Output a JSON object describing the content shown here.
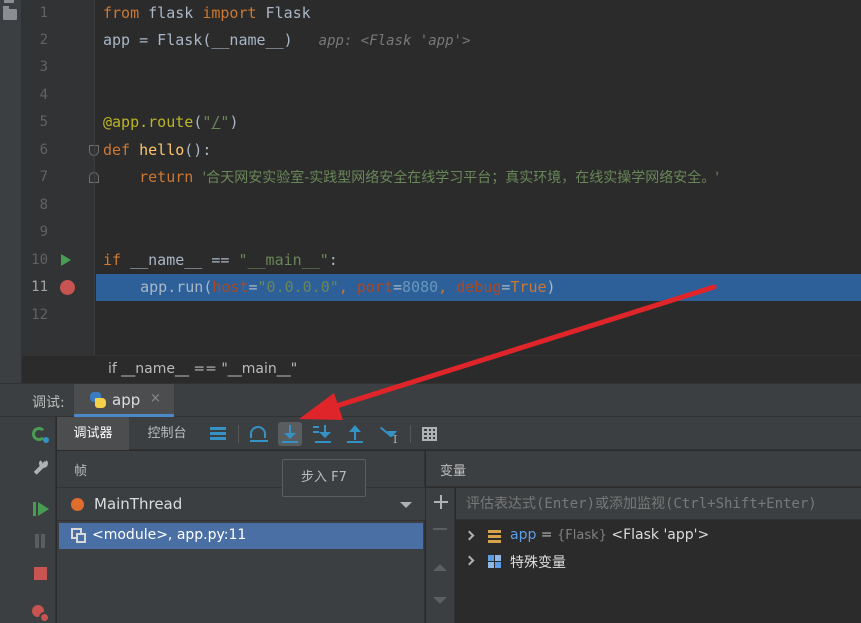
{
  "editor": {
    "line_numbers": [
      "1",
      "2",
      "3",
      "4",
      "5",
      "6",
      "7",
      "8",
      "9",
      "10",
      "11",
      "12"
    ],
    "lines": {
      "l1": {
        "kw1": "from",
        "mod": " flask ",
        "kw2": "import",
        "name": " Flask"
      },
      "l2": {
        "pre": "app = Flask(__name__)",
        "hint": "app: <Flask 'app'>"
      },
      "l5": {
        "dec": "@app.route",
        "p1": "(",
        "q1": "\"",
        "path": "/",
        "q2": "\"",
        "p2": ")"
      },
      "l6": {
        "kw": "def",
        "sp": " ",
        "fn": "hello",
        "rest": "():"
      },
      "l7": {
        "indent": "    ",
        "kw": "return",
        "sp": " ",
        "str": "'合天网安实验室-实践型网络安全在线学习平台；真实环境，在线实操学网络安全。'"
      },
      "l10": {
        "kw": "if",
        "rest": " __name__ == ",
        "str": "\"__main__\"",
        "colon": ":"
      },
      "l11": {
        "indent": "    ",
        "call": "app.run(",
        "p1": "host",
        "eq1": "=",
        "s1": "\"0.0.0.0\"",
        "c1": ", ",
        "p2": "port",
        "eq2": "=",
        "n1": "8080",
        "c2": ", ",
        "p3": "debug",
        "eq3": "=",
        "kw": "True",
        "close": ")"
      }
    },
    "breadcrumb": "if __name__ == \"__main__\""
  },
  "debug": {
    "label": "调试:",
    "tab_name": "app",
    "tab_close": "×",
    "subtabs": {
      "debugger": "调试器",
      "console": "控制台"
    },
    "tooltip": "步入  F7",
    "frames": {
      "title": "帧",
      "thread": "MainThread",
      "frame": "<module>, app.py:11"
    },
    "variables": {
      "title": "变量",
      "eval_placeholder": "评估表达式(Enter)或添加监视(Ctrl+Shift+Enter)",
      "rows": [
        {
          "name": "app",
          "eq": " = ",
          "type": "{Flask}",
          "value": " <Flask 'app'>"
        },
        {
          "name": "特殊变量"
        }
      ]
    }
  },
  "colors": {
    "background": "#2b2b2b",
    "selection": "#2d5f99",
    "keyword": "#cc7832",
    "string": "#6a8759",
    "breakpoint": "#c75450",
    "run": "#499c54",
    "accent": "#3592c4",
    "annotation_arrow": "#e0252a"
  }
}
